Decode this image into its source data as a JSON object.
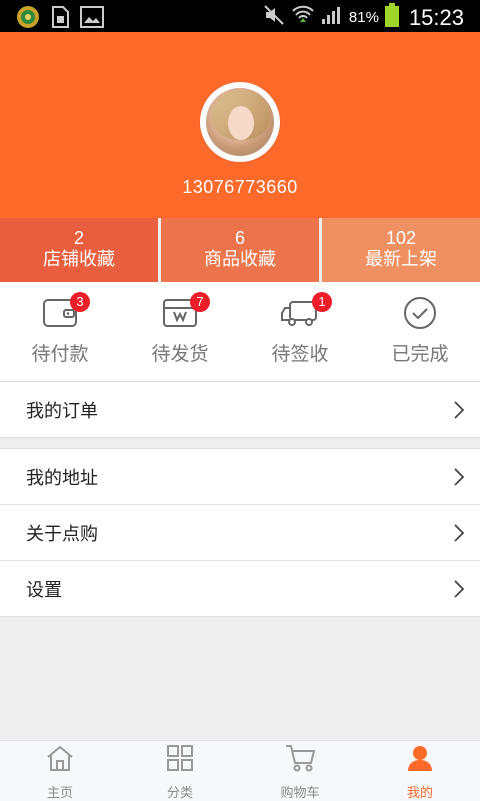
{
  "status_bar": {
    "battery": "81%",
    "time": "15:23"
  },
  "profile": {
    "phone": "13076773660"
  },
  "stats": [
    {
      "count": "2",
      "label": "店铺收藏"
    },
    {
      "count": "6",
      "label": "商品收藏"
    },
    {
      "count": "102",
      "label": "最新上架"
    }
  ],
  "orders": [
    {
      "label": "待付款",
      "badge": "3",
      "icon": "wallet-icon"
    },
    {
      "label": "待发货",
      "badge": "7",
      "icon": "package-icon"
    },
    {
      "label": "待签收",
      "badge": "1",
      "icon": "truck-icon"
    },
    {
      "label": "已完成",
      "badge": "",
      "icon": "check-circle-icon"
    }
  ],
  "menu": {
    "my_orders": "我的订单",
    "my_address": "我的地址",
    "about": "关于点购",
    "settings": "设置"
  },
  "tabs": [
    {
      "label": "主页",
      "icon": "home-icon"
    },
    {
      "label": "分类",
      "icon": "grid-icon"
    },
    {
      "label": "购物车",
      "icon": "cart-icon"
    },
    {
      "label": "我的",
      "icon": "user-icon",
      "active": true
    }
  ],
  "colors": {
    "brand": "#ff6a2a",
    "badge": "#ee1d2a"
  }
}
